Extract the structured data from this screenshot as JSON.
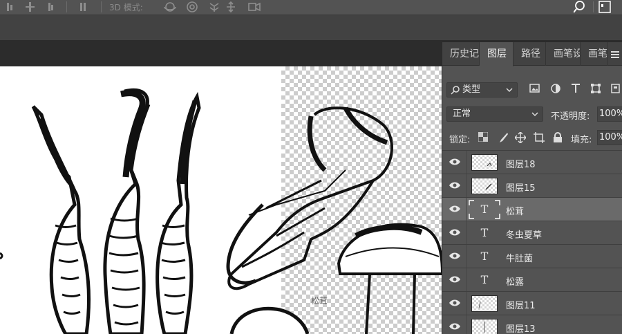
{
  "options_bar": {
    "mode_3d_label": "3D 模式:"
  },
  "panel": {
    "tabs": [
      {
        "label": "历史记"
      },
      {
        "label": "图层"
      },
      {
        "label": "路径"
      },
      {
        "label": "画笔设"
      },
      {
        "label": "画笔"
      }
    ],
    "kind_filter": "类型",
    "blend_mode": "正常",
    "opacity_label": "不透明度:",
    "opacity_value": "100%",
    "lock_label": "锁定:",
    "fill_label": "填充:",
    "fill_value": "100%",
    "layers": [
      {
        "name": "图层18",
        "type": "image",
        "visible": true
      },
      {
        "name": "图层15",
        "type": "image",
        "visible": true
      },
      {
        "name": "松茸",
        "type": "text",
        "visible": true,
        "selected": true
      },
      {
        "name": "冬虫夏草",
        "type": "text",
        "visible": true
      },
      {
        "name": "牛肚菌",
        "type": "text",
        "visible": true
      },
      {
        "name": "松露",
        "type": "text",
        "visible": true
      },
      {
        "name": "图层11",
        "type": "image",
        "visible": true
      },
      {
        "name": "图层13",
        "type": "image",
        "visible": true
      }
    ]
  },
  "canvas": {
    "label_text": "松茸"
  },
  "colors": {
    "panel_bg": "#535353",
    "selected_row": "#6a6a6a",
    "app_bg": "#282828"
  }
}
